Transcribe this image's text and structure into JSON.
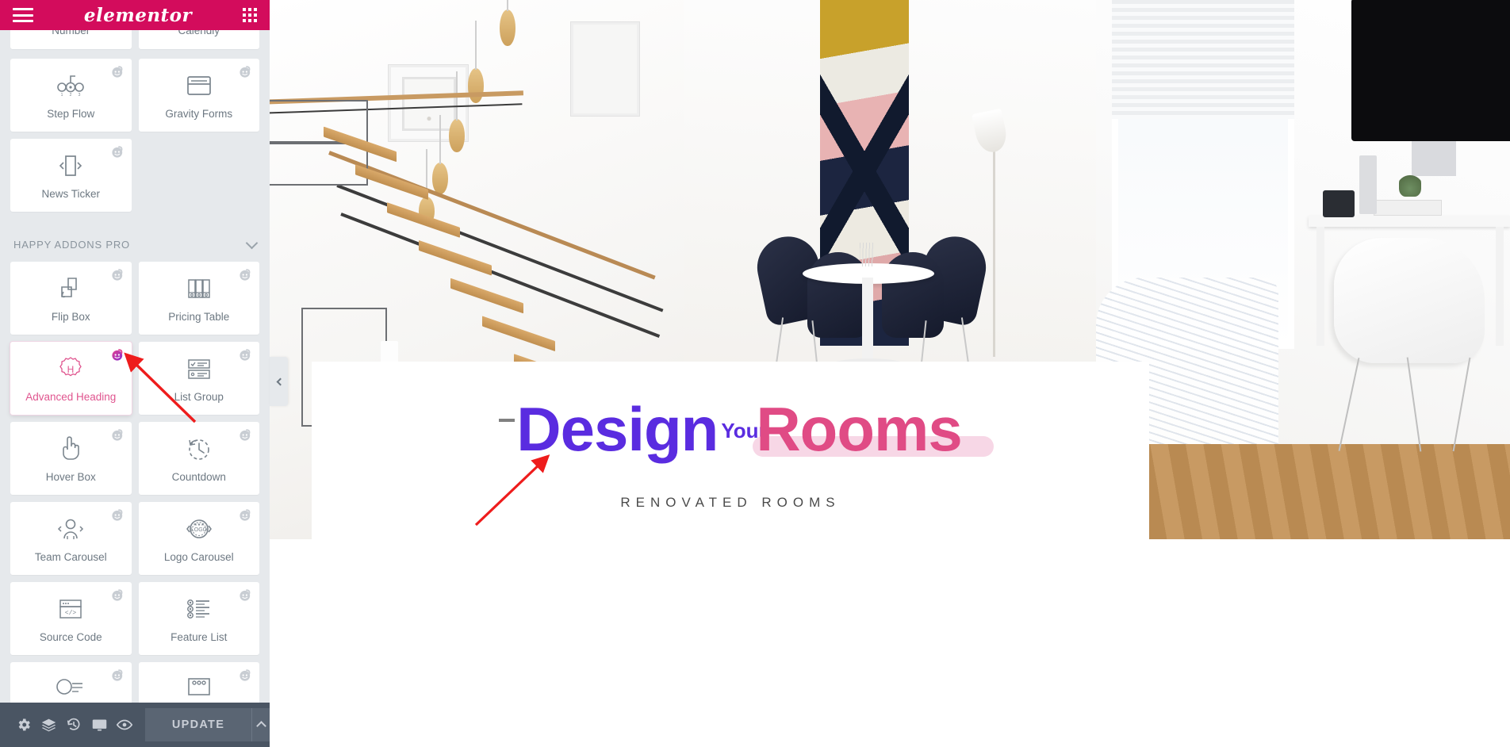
{
  "app": {
    "brand": "elementor",
    "header_icons": {
      "menu": "hamburger-menu-icon",
      "apps": "widgets-grid-icon"
    }
  },
  "panel": {
    "collapse_tooltip": "Hide Panel",
    "sections": [
      {
        "title": "",
        "widgets": [
          {
            "label": "Number",
            "icon": "number-counter-icon",
            "pro": true,
            "cut": true
          },
          {
            "label": "Calendly",
            "icon": "calendly-icon",
            "pro": true,
            "cut": true
          },
          {
            "label": "Step Flow",
            "icon": "step-flow-icon",
            "pro": true
          },
          {
            "label": "Gravity Forms",
            "icon": "gravity-forms-icon",
            "pro": true
          },
          {
            "label": "News Ticker",
            "icon": "news-ticker-icon",
            "pro": true
          }
        ]
      },
      {
        "title": "HAPPY ADDONS PRO",
        "collapsed": false,
        "widgets": [
          {
            "label": "Flip Box",
            "icon": "flip-box-icon",
            "pro": true
          },
          {
            "label": "Pricing Table",
            "icon": "pricing-table-icon",
            "pro": true
          },
          {
            "label": "Advanced Heading",
            "icon": "advanced-heading-icon",
            "pro": true,
            "active": true
          },
          {
            "label": "List Group",
            "icon": "list-group-icon",
            "pro": true
          },
          {
            "label": "Hover Box",
            "icon": "hover-box-icon",
            "pro": true
          },
          {
            "label": "Countdown",
            "icon": "countdown-icon",
            "pro": true
          },
          {
            "label": "Team Carousel",
            "icon": "team-carousel-icon",
            "pro": true
          },
          {
            "label": "Logo Carousel",
            "icon": "logo-carousel-icon",
            "pro": true
          },
          {
            "label": "Source Code",
            "icon": "source-code-icon",
            "pro": true
          },
          {
            "label": "Feature List",
            "icon": "feature-list-icon",
            "pro": true
          },
          {
            "label": "",
            "icon": "info-box-icon",
            "pro": true,
            "partial": true
          },
          {
            "label": "",
            "icon": "card-icon",
            "pro": true,
            "partial": true
          }
        ]
      }
    ]
  },
  "footer": {
    "settings_label": "Settings",
    "navigator_label": "Navigator",
    "history_label": "History",
    "responsive_label": "Responsive Mode",
    "preview_label": "Preview Changes",
    "update_label": "UPDATE",
    "caret_label": "Save Options"
  },
  "canvas": {
    "heading": {
      "dash": "—",
      "first_word": "Design",
      "superscript": "Your",
      "second_word": "Rooms",
      "first_word_color": "#5a2ce0",
      "superscript_color": "#5a2ce0",
      "second_word_color": "#e04b85",
      "highlight_color": "#f7d7e6"
    },
    "subheading": "RENOVATED ROOMS"
  },
  "colors": {
    "brand_pink": "#d30c5c",
    "panel_bg": "#e6e9ec",
    "card_bg": "#ffffff",
    "footer_bg": "#4a5563",
    "accent_purple": "#5a2ce0",
    "accent_pink": "#e04b85",
    "annotation_red": "#ee1c1c"
  },
  "annotations": [
    {
      "type": "arrow",
      "target": "advanced-heading-widget",
      "color": "#ee1c1c"
    },
    {
      "type": "arrow",
      "target": "canvas-heading",
      "color": "#ee1c1c"
    }
  ]
}
